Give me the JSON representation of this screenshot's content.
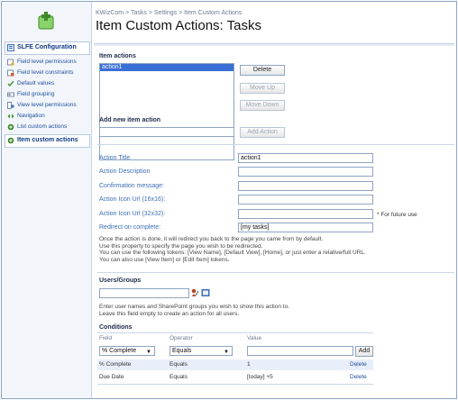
{
  "nav": {
    "items": [
      {
        "label": "SLFE Configuration",
        "icon": "slfe-config-icon",
        "selected": true
      },
      {
        "label": "Field level permissions",
        "icon": "field-permissions-icon"
      },
      {
        "label": "Field level constraints",
        "icon": "field-constraints-icon"
      },
      {
        "label": "Default values",
        "icon": "default-values-icon"
      },
      {
        "label": "Field grouping",
        "icon": "field-grouping-icon"
      },
      {
        "label": "View level permissions",
        "icon": "view-permissions-icon"
      },
      {
        "label": "Navigation",
        "icon": "navigation-icon"
      },
      {
        "label": "List custom actions",
        "icon": "list-actions-icon"
      },
      {
        "label": "Item custom actions",
        "icon": "item-actions-icon",
        "selected": true
      }
    ]
  },
  "breadcrumb": "KWizCom > Tasks > Settings > Item Custom Actions",
  "title": "Item Custom Actions: Tasks",
  "item_actions": {
    "heading": "Item actions",
    "options": [
      "action1"
    ],
    "delete_label": "Delete",
    "move_up_label": "Move Up",
    "move_down_label": "Move Down"
  },
  "add_new": {
    "heading": "Add new item action",
    "input_value": "",
    "button_label": "Add Action"
  },
  "fields": {
    "action_title": {
      "label": "Action Title",
      "value": "action1"
    },
    "action_description": {
      "label": "Action Description",
      "value": ""
    },
    "confirmation_message": {
      "label": "Confirmation message:",
      "value": ""
    },
    "icon16": {
      "label": "Action Icon Url (16x16):",
      "value": ""
    },
    "icon32": {
      "label": "Action Icon Url (32x32):",
      "value": "",
      "note": "* For future use"
    },
    "redirect": {
      "label": "Redirect on complete:",
      "value": "[my tasks]"
    }
  },
  "redirect_help": [
    "Once the action is done, it will redirect you back to the page you came from by default.",
    "Use this property to specify the page you wish to be redirected.",
    "You can use the following tokens: [View Name], [Default View], [Home], or just enter a relative/full URL.",
    "You can also use [View Item] or [Edit Item] tokens."
  ],
  "users_groups": {
    "heading": "Users/Groups",
    "value": "",
    "help": [
      "Enter user names and SharePoint groups you wish to show this action to.",
      "Leave this field empty to create an action for all users."
    ]
  },
  "conditions": {
    "heading": "Conditions",
    "columns": {
      "field": "Field",
      "operator": "Operator",
      "value": "Value"
    },
    "new_field": "% Complete",
    "new_operator": "Equals",
    "new_value": "",
    "add_label": "Add",
    "rows": [
      {
        "field": "% Complete",
        "operator": "Equals",
        "value": "1",
        "action": "Delete"
      },
      {
        "field": "Due Date",
        "operator": "Equals",
        "value": "[today] +5",
        "action": "Delete"
      }
    ]
  },
  "colors": {
    "link": "#1f4e9a",
    "label": "#3b6fb5",
    "selected_option": "#3a6fd6",
    "nav_bg": "#f2f6fb"
  }
}
